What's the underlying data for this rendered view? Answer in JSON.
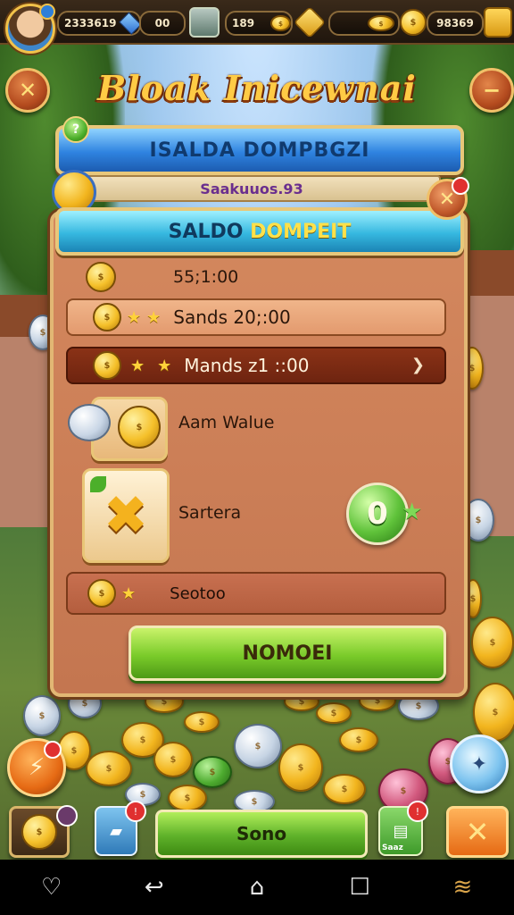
{
  "hud": {
    "stat_1": "2333619",
    "stat_2": "00",
    "stat_3": "189",
    "stat_4": "6",
    "stat_5": "98369"
  },
  "title": "Bloak Inicewnai",
  "banner": {
    "title": "ISALDA DOMPBGZI",
    "badge_label": "?",
    "subtitle": "Saakuuos.93"
  },
  "panel": {
    "header_part1": "SALDO",
    "header_part2": "DOMPEIT",
    "row_plain_value": "55;1:00",
    "row_light_value": "Sands 20;:00",
    "row_dark_value": "Mands z1 ::00",
    "tile1_label": "Aam Walue",
    "tile2_label": "Sartera",
    "orb_value": "0",
    "bottom_row_label": "Seotoo",
    "action_button": "NOMOEI"
  },
  "bottom_bar": {
    "main_button": "Sono",
    "tile3_caption": "Saaz",
    "badge_2": "!",
    "badge_3": "!"
  },
  "nav": {
    "icons": [
      "heart-icon",
      "back-icon",
      "home-icon",
      "recents-icon",
      "menu-icon"
    ]
  },
  "colors": {
    "title_gold": "#ffcb45",
    "banner_blue": "#2f83e0",
    "header_cyan": "#36b8e0",
    "panel_brown": "#c47650",
    "action_green": "#7acb2a"
  }
}
